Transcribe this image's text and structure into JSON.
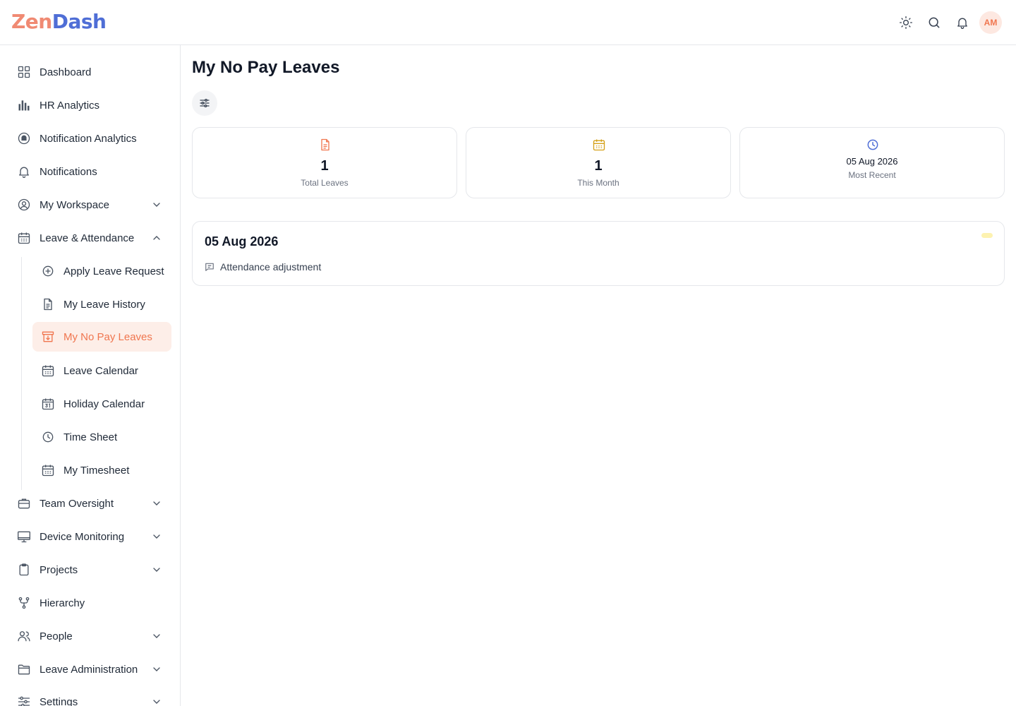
{
  "app": {
    "logo_part1": "Zen",
    "logo_part2": "Dash"
  },
  "header": {
    "avatar_initials": "AM",
    "icons": [
      "sun-icon",
      "search-icon",
      "bell-icon"
    ]
  },
  "sidebar": {
    "items": [
      {
        "label": "Dashboard",
        "icon": "grid-icon"
      },
      {
        "label": "HR Analytics",
        "icon": "bar-chart-icon"
      },
      {
        "label": "Notification Analytics",
        "icon": "bell-circle-icon"
      },
      {
        "label": "Notifications",
        "icon": "bell-icon"
      },
      {
        "label": "My Workspace",
        "icon": "user-circle-icon",
        "expandable": true
      },
      {
        "label": "Leave & Attendance",
        "icon": "calendar-icon",
        "expanded": true
      },
      {
        "label": "Team Oversight",
        "icon": "briefcase-icon",
        "expandable": true
      },
      {
        "label": "Device Monitoring",
        "icon": "monitor-icon",
        "expandable": true
      },
      {
        "label": "Projects",
        "icon": "clipboard-icon",
        "expandable": true
      },
      {
        "label": "Hierarchy",
        "icon": "branch-icon"
      },
      {
        "label": "People",
        "icon": "users-icon",
        "expandable": true
      },
      {
        "label": "Leave Administration",
        "icon": "folder-icon",
        "expandable": true
      },
      {
        "label": "Settings",
        "icon": "sliders-icon",
        "expandable": true
      }
    ],
    "leave_submenu": [
      {
        "label": "Apply Leave Request",
        "icon": "plus-circle-icon"
      },
      {
        "label": "My Leave History",
        "icon": "document-icon"
      },
      {
        "label": "My No Pay Leaves",
        "icon": "archive-icon",
        "active": true
      },
      {
        "label": "Leave Calendar",
        "icon": "calendar-icon"
      },
      {
        "label": "Holiday Calendar",
        "icon": "calendar-31-icon"
      },
      {
        "label": "Time Sheet",
        "icon": "clock-icon"
      },
      {
        "label": "My Timesheet",
        "icon": "calendar-icon"
      }
    ]
  },
  "main": {
    "title": "My No Pay Leaves",
    "stats": {
      "total": {
        "value": "1",
        "label": "Total Leaves"
      },
      "month": {
        "value": "1",
        "label": "This Month"
      },
      "recent": {
        "value": "05 Aug 2026",
        "label": "Most Recent"
      }
    },
    "leaves": [
      {
        "date": "05 Aug 2026",
        "reason": "Attendance adjustment"
      }
    ]
  },
  "colors": {
    "accent": "#f0764f",
    "accent_bg": "#fdeee8",
    "calendar_icon": "#d4a017",
    "clock_icon": "#4f6ed6",
    "status_pill": "#fdf2b0"
  }
}
